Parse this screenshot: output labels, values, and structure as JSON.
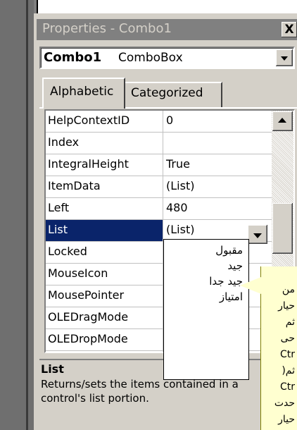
{
  "window": {
    "title": "Properties - Combo1",
    "close_label": "X"
  },
  "object_combo": {
    "name": "Combo1",
    "type": "ComboBox"
  },
  "tabs": [
    {
      "label": "Alphabetic",
      "active": true
    },
    {
      "label": "Categorized",
      "active": false
    }
  ],
  "properties": [
    {
      "name": "HelpContextID",
      "value": "0"
    },
    {
      "name": "Index",
      "value": ""
    },
    {
      "name": "IntegralHeight",
      "value": "True"
    },
    {
      "name": "ItemData",
      "value": "(List)"
    },
    {
      "name": "Left",
      "value": "480"
    },
    {
      "name": "List",
      "value": "(List)",
      "selected": true
    },
    {
      "name": "Locked",
      "value": ""
    },
    {
      "name": "MouseIcon",
      "value": ""
    },
    {
      "name": "MousePointer",
      "value": ""
    },
    {
      "name": "OLEDragMode",
      "value": ""
    },
    {
      "name": "OLEDropMode",
      "value": ""
    }
  ],
  "list_popup": {
    "items": [
      "مقبول",
      "جيد",
      "جيد جدا",
      "امتياز"
    ]
  },
  "description": {
    "title": "List",
    "text": "Returns/sets the items contained in a control's list portion."
  },
  "tooltip": {
    "lines": [
      "من",
      "حيار",
      "ثم",
      "حى",
      "Ctr",
      "ثم(",
      "Ctr",
      "حدت",
      "حيار"
    ]
  },
  "colors": {
    "selection": "#0a246a",
    "face": "#d4d0c8",
    "tooltip": "#ffffd0"
  }
}
